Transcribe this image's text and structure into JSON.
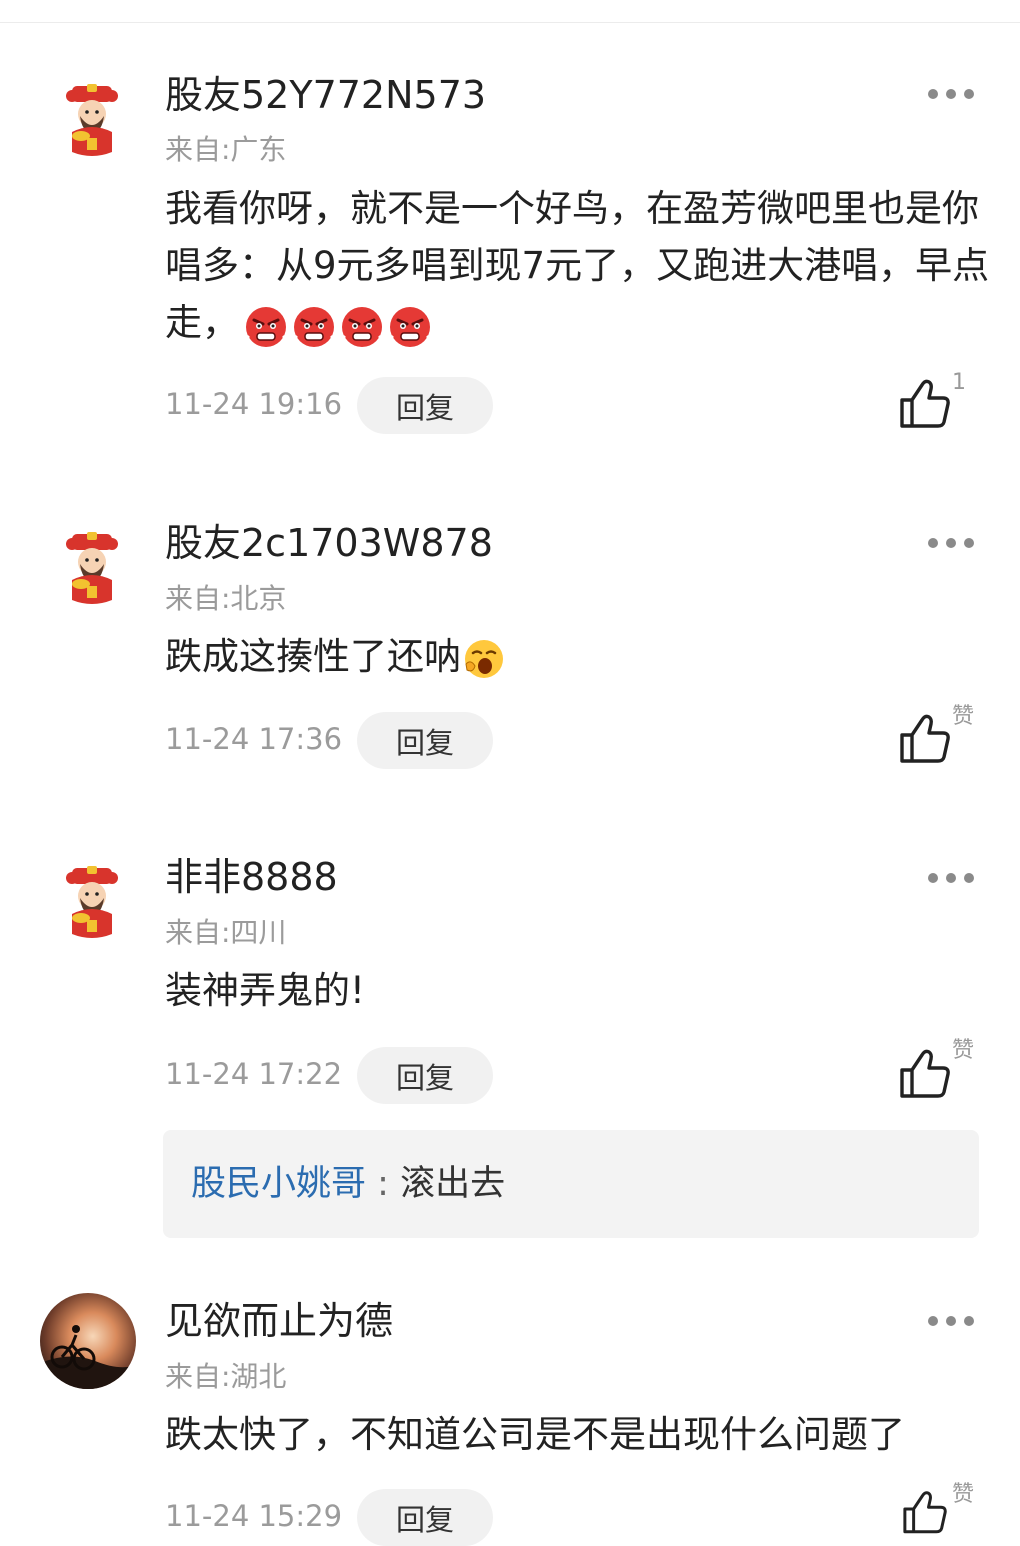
{
  "comments": [
    {
      "username": "股友52Y772N573",
      "location": "来自:广东",
      "content": "我看你呀，就不是一个好鸟，在盈芳微吧里也是你唱多：从9元多唱到现7元了，又跑进大港唱，早点走，",
      "emoji_count": 4,
      "time": "11-24 19:16",
      "reply_label": "回复",
      "like_count": "1",
      "avatar": "caishen-avatar"
    },
    {
      "username": "股友2c1703W878",
      "location": "来自:北京",
      "content": "跌成这揍性了还呐",
      "time": "11-24 17:36",
      "reply_label": "回复",
      "like_count": "赞",
      "avatar": "caishen-avatar"
    },
    {
      "username": "非非8888",
      "location": "来自:四川",
      "content": "装神弄鬼的!",
      "time": "11-24 17:22",
      "reply_label": "回复",
      "like_count": "赞",
      "avatar": "caishen-avatar",
      "sub_reply": {
        "name": "股民小姚哥",
        "separator": " : ",
        "text": "滚出去"
      }
    },
    {
      "username": "见欲而止为德",
      "location": "来自:湖北",
      "content": "跌太快了，不知道公司是不是出现什么问题了",
      "time": "11-24 15:29",
      "reply_label": "回复",
      "like_count": "赞",
      "avatar": "cyclist-sunset-avatar"
    }
  ],
  "icons": {
    "more": "more-dots-icon",
    "like": "thumbs-up-icon",
    "angry": "angry-face-emoji",
    "yawn": "yawning-face-emoji"
  },
  "colors": {
    "link": "#2b6cb0",
    "secondary_text": "#9b9b9b",
    "reply_button_bg": "#f1f1f1",
    "sub_reply_bg": "#f3f3f3"
  }
}
